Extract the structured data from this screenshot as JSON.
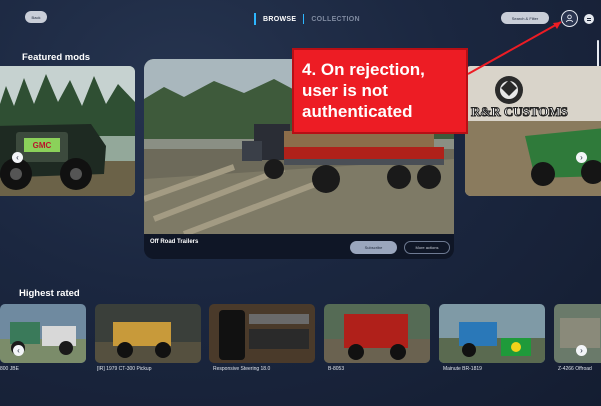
{
  "topbar": {
    "back_label": "Back",
    "tabs": [
      {
        "label": "BROWSE",
        "active": true
      },
      {
        "label": "COLLECTION",
        "active": false
      }
    ],
    "search_label": "Search & Filter",
    "accent_color": "#2db6ff"
  },
  "featured": {
    "title": "Featured mods",
    "main": {
      "name": "Off Road Trailers",
      "subscribe_label": "Subscribe",
      "more_label": "More actions"
    },
    "right_logo_text": "R&R CUSTOMS",
    "left_badge_text": "GMC"
  },
  "annotation": {
    "text_line1": "4. On rejection,",
    "text_line2": "user is not",
    "text_line3": "authenticated",
    "color": "#ed1c24"
  },
  "highest_rated": {
    "title": "Highest rated",
    "items": [
      {
        "label": "800 JBE"
      },
      {
        "label": "[IR] 1979 CT-300 Pickup"
      },
      {
        "label": "Responsive Steering 18.0"
      },
      {
        "label": "B-8053"
      },
      {
        "label": "Mainute BR-1819"
      },
      {
        "label": "Z-4266 Offroad"
      }
    ]
  },
  "icons": {
    "profile": "user-icon",
    "menu": "menu-icon",
    "prev": "chevron-left-icon",
    "next": "chevron-right-icon"
  }
}
